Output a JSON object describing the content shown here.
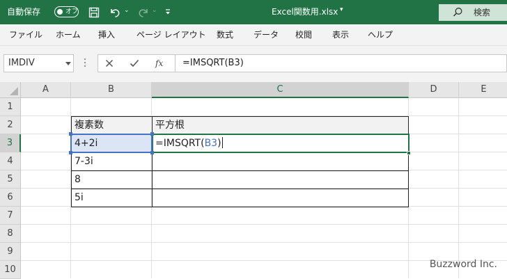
{
  "titlebar": {
    "autosave_label": "自動保存",
    "autosave_state": "オフ",
    "filename": "Excel関数用.xlsx",
    "search_label": "検索",
    "accent": "#217346"
  },
  "ribbon_tabs": [
    "ファイル",
    "ホーム",
    "挿入",
    "ページ レイアウト",
    "数式",
    "データ",
    "校閲",
    "表示",
    "ヘルプ"
  ],
  "formula_bar": {
    "name_box": "IMDIV",
    "fx_label": "fx",
    "formula": "=IMSQRT(B3)"
  },
  "sheet": {
    "columns": [
      "A",
      "B",
      "C",
      "D",
      "E"
    ],
    "selected_column": "C",
    "rows": [
      "1",
      "2",
      "3",
      "4",
      "5",
      "6",
      "7",
      "8",
      "9",
      "10"
    ],
    "selected_row": "3",
    "table": {
      "header": [
        "複素数",
        "平方根"
      ],
      "values_b": [
        "4+2i",
        "7-3i",
        "8",
        "5i"
      ],
      "edit_prefix": "=IMSQRT(",
      "edit_ref": "B3",
      "edit_suffix": ")",
      "ref_color": "#4472c4"
    }
  },
  "watermark": "Buzzword Inc."
}
